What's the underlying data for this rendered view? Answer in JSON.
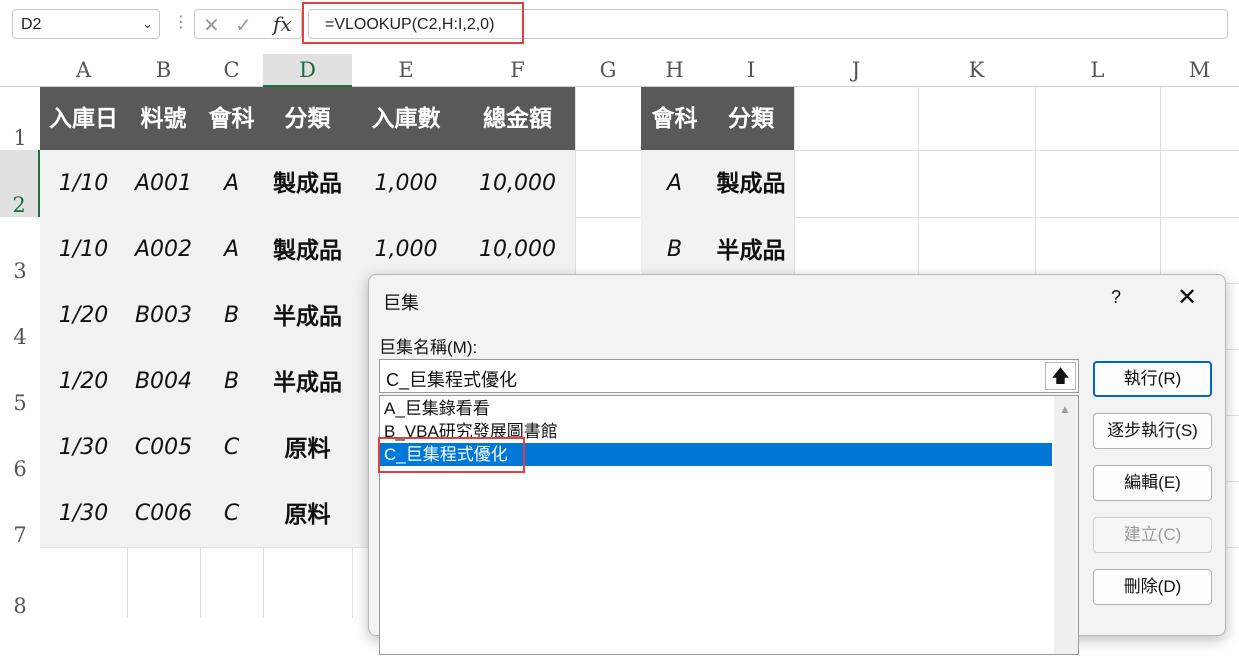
{
  "formula_bar": {
    "name_box": "D2",
    "formula": "=VLOOKUP(C2,H:I,2,0)",
    "fx_label": "fx",
    "cancel_glyph": "✕",
    "enter_glyph": "✓",
    "separator": "⋮",
    "name_box_arrow": "⌄"
  },
  "columns": [
    "A",
    "B",
    "C",
    "D",
    "E",
    "F",
    "G",
    "H",
    "I",
    "J",
    "K",
    "L",
    "M"
  ],
  "selected_column": "D",
  "rows": [
    "1",
    "2",
    "3",
    "4",
    "5",
    "6",
    "7",
    "8"
  ],
  "selected_row": "2",
  "table_headers": [
    "入庫日",
    "料號",
    "會科",
    "分類",
    "入庫數",
    "總金額"
  ],
  "table_rows": [
    [
      "1/10",
      "A001",
      "A",
      "製成品",
      "1,000",
      "10,000"
    ],
    [
      "1/10",
      "A002",
      "A",
      "製成品",
      "1,000",
      "10,000"
    ],
    [
      "1/20",
      "B003",
      "B",
      "半成品",
      "",
      ""
    ],
    [
      "1/20",
      "B004",
      "B",
      "半成品",
      "",
      ""
    ],
    [
      "1/30",
      "C005",
      "C",
      "原料",
      "",
      ""
    ],
    [
      "1/30",
      "C006",
      "C",
      "原料",
      "",
      ""
    ]
  ],
  "lookup_headers": [
    "會科",
    "分類"
  ],
  "lookup_rows": [
    [
      "A",
      "製成品"
    ],
    [
      "B",
      "半成品"
    ]
  ],
  "macro_dialog": {
    "title": "巨集",
    "help": "?",
    "close": "✕",
    "name_label": "巨集名稱(M):",
    "name_value": "C_巨集程式優化",
    "upload_icon": "🡅",
    "macros": [
      "A_巨集錄看看",
      "B_VBA研究發展圖書館",
      "C_巨集程式優化"
    ],
    "selected_index": 2,
    "scroll_up": "▲",
    "buttons": [
      {
        "label": "執行(R)",
        "state": "primary"
      },
      {
        "label": "逐步執行(S)",
        "state": "normal"
      },
      {
        "label": "編輯(E)",
        "state": "normal"
      },
      {
        "label": "建立(C)",
        "state": "disabled"
      },
      {
        "label": "刪除(D)",
        "state": "normal"
      }
    ]
  },
  "colors": {
    "header_fill": "#595959",
    "data_fill": "#f2f2f2",
    "highlight_border": "#e04040",
    "selection_green": "#1e7145",
    "list_selection": "#0078d7"
  }
}
